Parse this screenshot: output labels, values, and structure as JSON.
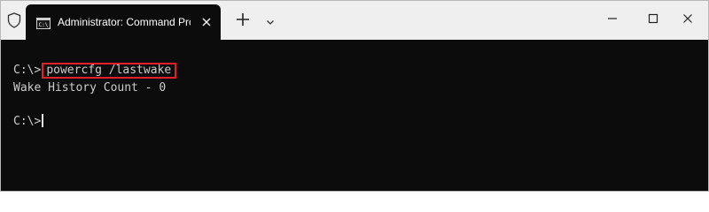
{
  "tab": {
    "title": "Administrator: Command Prompt",
    "icon": "cmd-icon"
  },
  "titlebar": {
    "icons": [
      "shield-icon",
      "new-tab-icon",
      "chevron-down-icon",
      "minimize-icon",
      "maximize-icon",
      "close-icon"
    ]
  },
  "terminal": {
    "prompt_1": "C:\\>",
    "command": "powercfg /lastwake",
    "output": "Wake History Count - 0",
    "prompt_2": "C:\\>"
  },
  "colors": {
    "titlebar_bg": "#efefef",
    "terminal_bg": "#0c0c0c",
    "terminal_text": "#cccccc",
    "highlight_border": "#e0202a"
  }
}
